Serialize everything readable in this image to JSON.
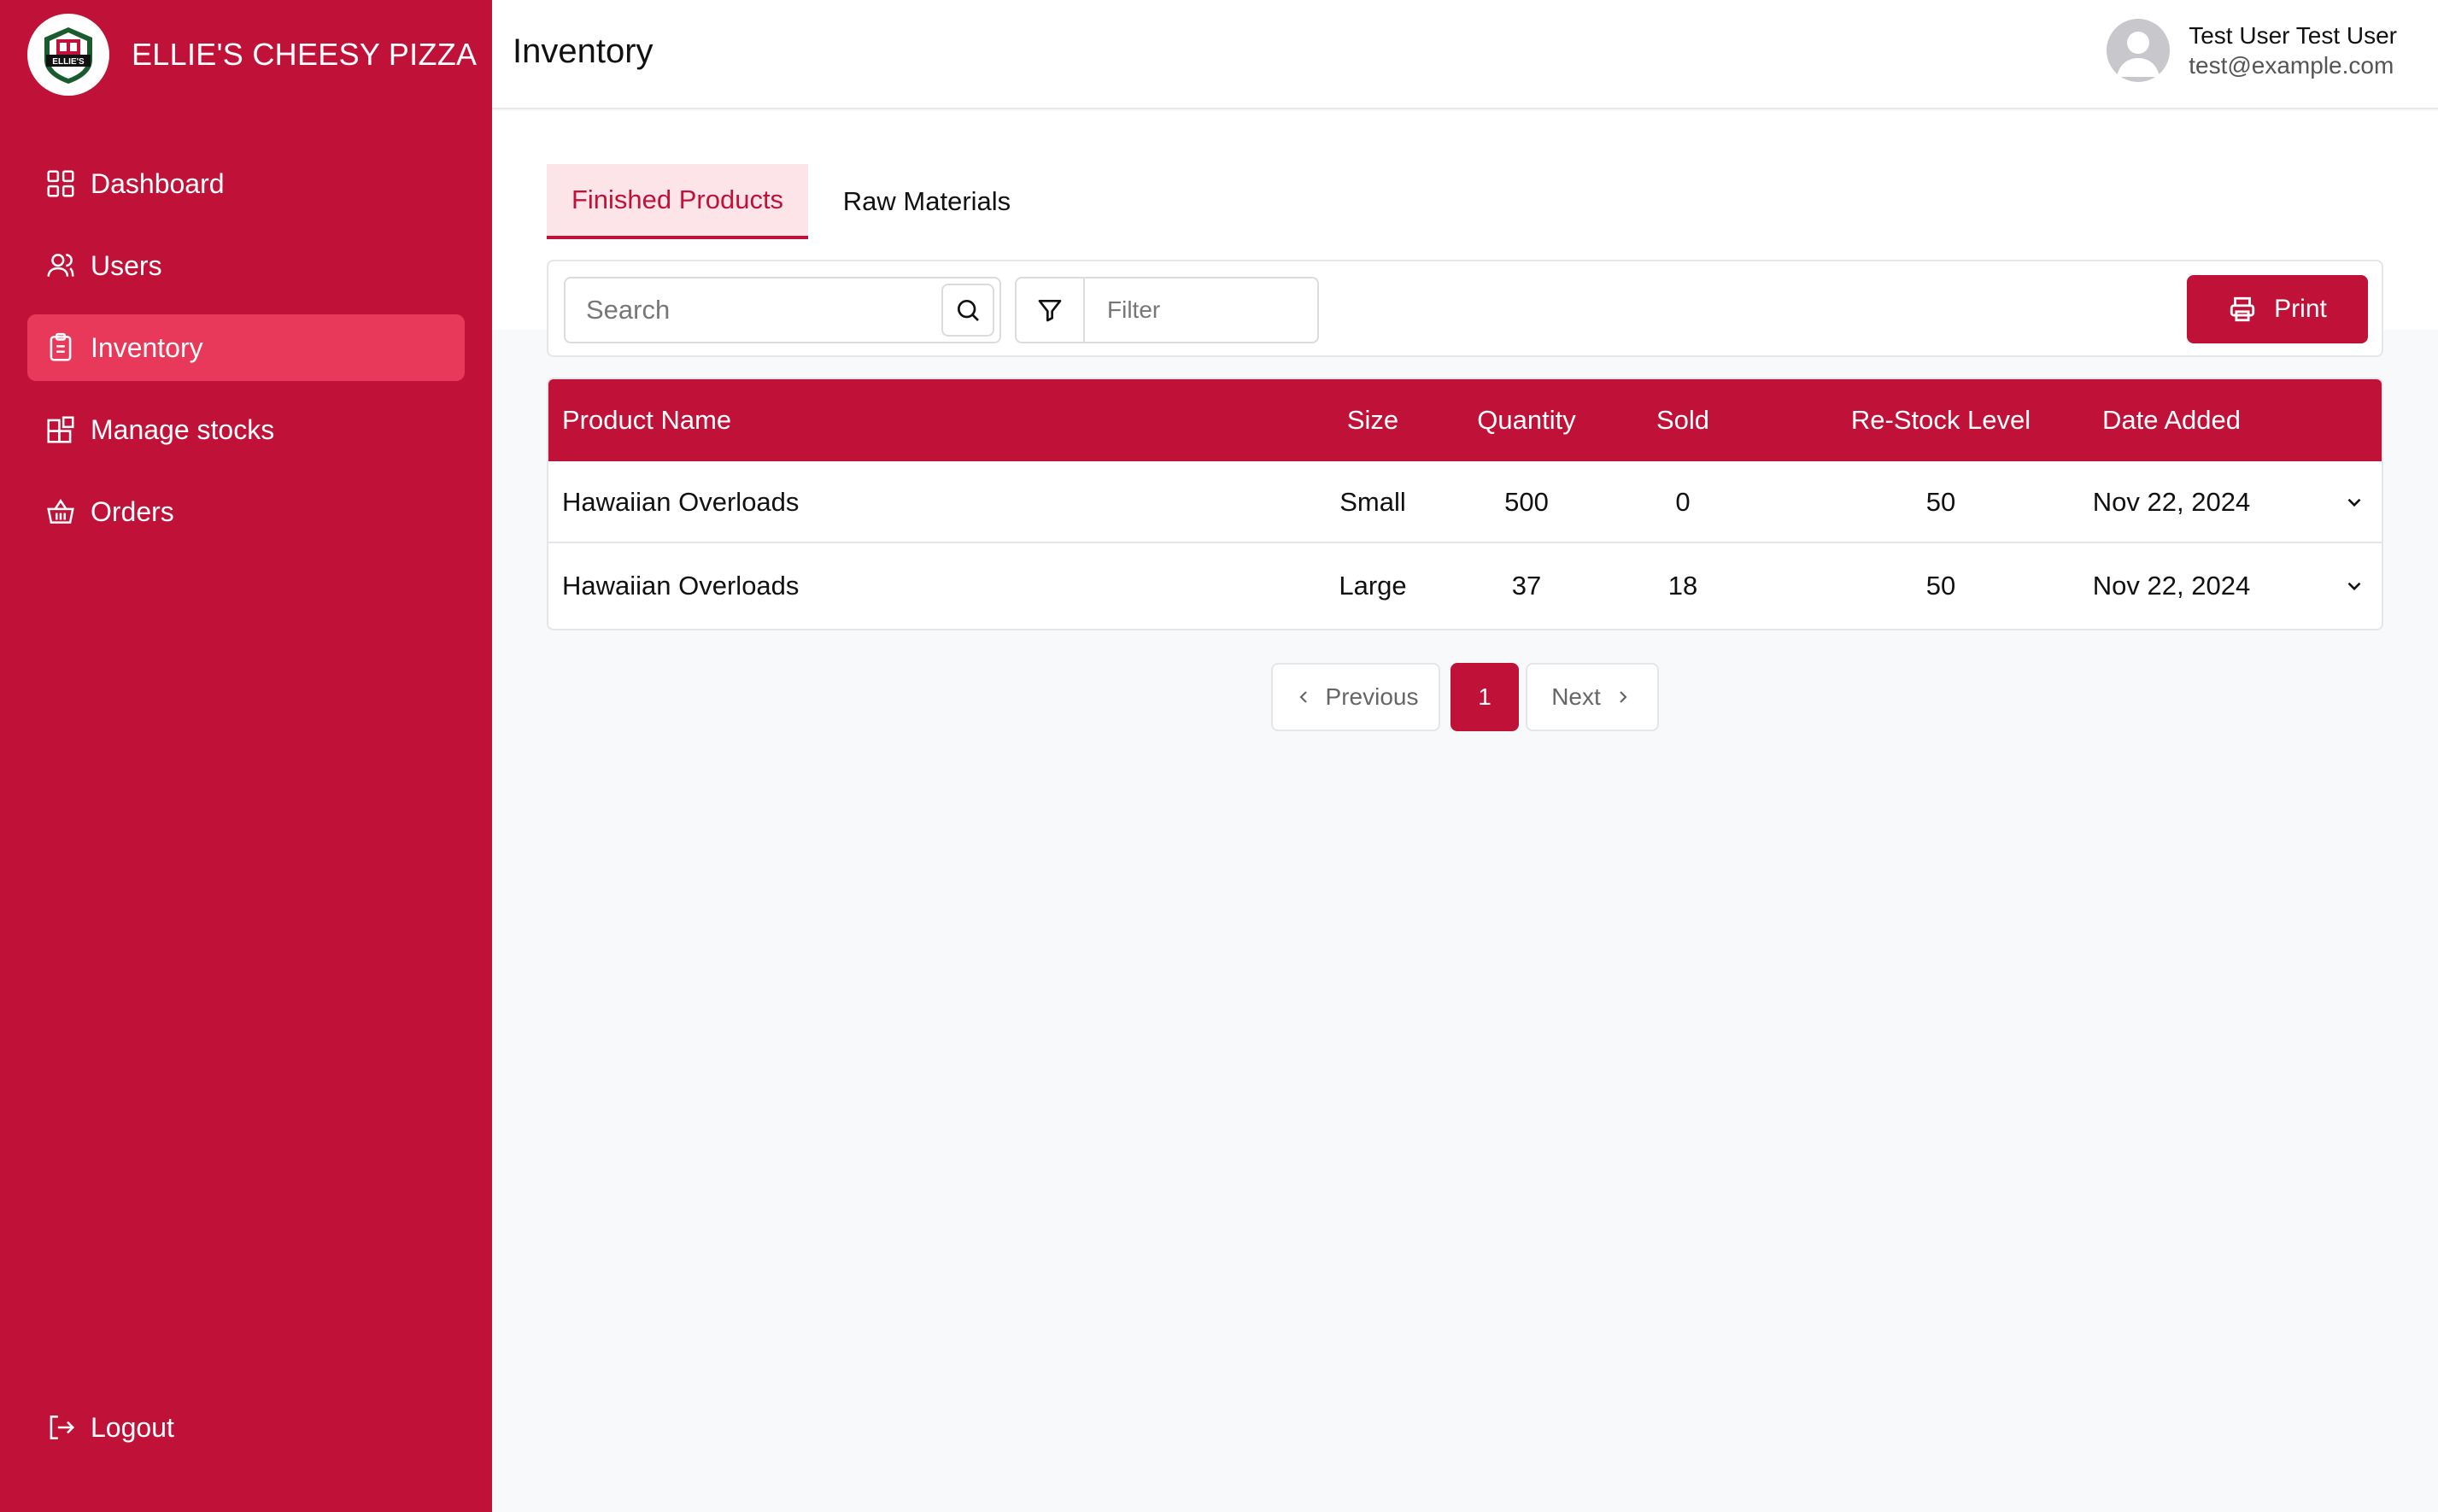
{
  "brand": {
    "name": "ELLIE'S CHEESY PIZZA",
    "logo_text": "ELLIE'S"
  },
  "sidebar": {
    "items": [
      {
        "label": "Dashboard",
        "icon": "grid-icon"
      },
      {
        "label": "Users",
        "icon": "users-icon"
      },
      {
        "label": "Inventory",
        "icon": "clipboard-icon"
      },
      {
        "label": "Manage stocks",
        "icon": "blocks-icon"
      },
      {
        "label": "Orders",
        "icon": "basket-icon"
      }
    ],
    "active": "Inventory",
    "logout": "Logout"
  },
  "header": {
    "title": "Inventory",
    "user_name": "Test User Test User",
    "user_email": "test@example.com"
  },
  "tabs": [
    {
      "label": "Finished Products",
      "active": true
    },
    {
      "label": "Raw Materials",
      "active": false
    }
  ],
  "toolbar": {
    "search_placeholder": "Search",
    "filter_placeholder": "Filter",
    "print_label": "Print"
  },
  "table": {
    "headers": [
      "Product Name",
      "Size",
      "Quantity",
      "Sold",
      "Re-Stock Level",
      "Date Added"
    ],
    "rows": [
      [
        "Hawaiian Overloads",
        "Small",
        "500",
        "0",
        "50",
        "Nov 22, 2024"
      ],
      [
        "Hawaiian Overloads",
        "Large",
        "37",
        "18",
        "50",
        "Nov 22, 2024"
      ]
    ]
  },
  "pagination": {
    "previous": "Previous",
    "current": "1",
    "next": "Next"
  },
  "colors": {
    "primary": "#c01238",
    "active_nav": "#e8395a",
    "tab_bg": "#fde4e9",
    "page_bg": "#f8f9fb"
  }
}
